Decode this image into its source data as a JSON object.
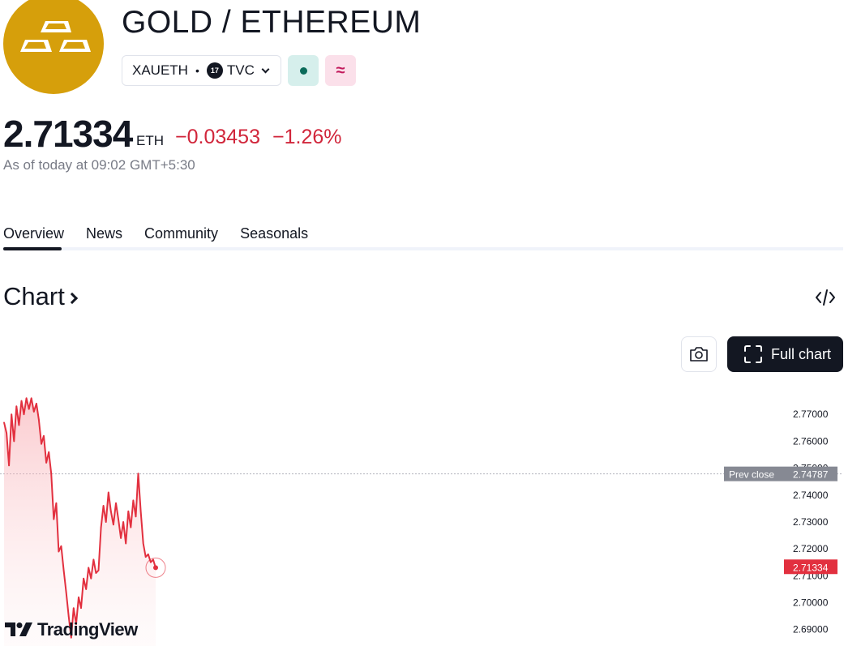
{
  "header": {
    "title": "GOLD / ETHEREUM",
    "symbol": "XAUETH",
    "separator": "•",
    "source_badge": "17",
    "source": "TVC",
    "pink_badge": "≈"
  },
  "quote": {
    "price": "2.71334",
    "currency": "ETH",
    "change": "−0.03453",
    "change_pct": "−1.26%",
    "as_of": "As of today at 09:02 GMT+5:30"
  },
  "tabs": [
    "Overview",
    "News",
    "Community",
    "Seasonals"
  ],
  "chart_section": {
    "title": "Chart",
    "full_chart_label": "Full chart",
    "watermark": "TradingView"
  },
  "colors": {
    "accent_gold": "#d69f0b",
    "negative": "#d1263b",
    "line": "#e2303f",
    "dark": "#131722"
  },
  "icons": [
    "gold-bars-icon",
    "chevron-down-icon",
    "chevron-right-icon",
    "code-icon",
    "camera-icon",
    "fullscreen-icon"
  ],
  "chart_data": {
    "type": "line",
    "y_ticks": [
      "2.77000",
      "2.76000",
      "2.75000",
      "2.74000",
      "2.73000",
      "2.72000",
      "2.71000",
      "2.70000",
      "2.69000"
    ],
    "ylim": [
      2.686,
      2.7794
    ],
    "prev_close_label": "Prev close",
    "prev_close": "2.74787",
    "last_price_label": "2.71334",
    "series": [
      {
        "values": [
          2.767,
          2.763,
          2.751,
          2.77,
          2.76,
          2.773,
          2.766,
          2.775,
          2.77,
          2.776,
          2.772,
          2.776,
          2.771,
          2.774,
          2.768,
          2.759,
          2.762,
          2.752,
          2.756,
          2.748,
          2.731,
          2.737,
          2.719,
          2.721,
          2.712,
          2.704,
          2.695,
          2.687,
          2.698,
          2.692,
          2.702,
          2.698,
          2.709,
          2.705,
          2.713,
          2.709,
          2.716,
          2.711,
          2.712,
          2.728,
          2.736,
          2.73,
          2.741,
          2.734,
          2.729,
          2.737,
          2.731,
          2.724,
          2.73,
          2.722,
          2.734,
          2.728,
          2.738,
          2.732,
          2.748,
          2.734,
          2.722,
          2.717,
          2.718,
          2.715,
          2.716,
          2.713
        ]
      }
    ]
  }
}
